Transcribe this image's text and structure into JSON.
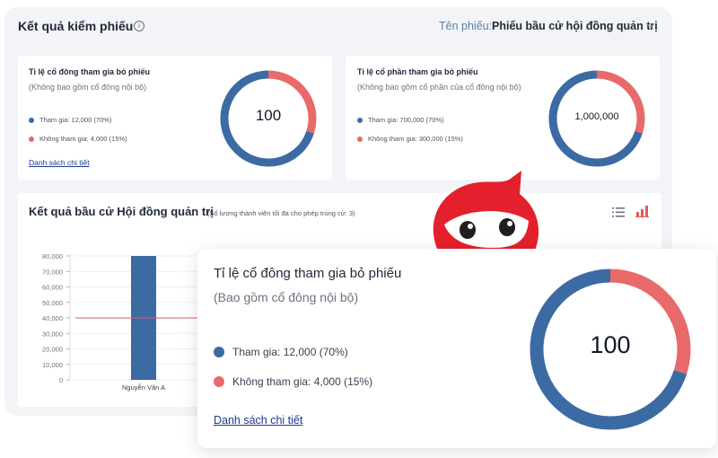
{
  "colors": {
    "participate": "#3c6aa3",
    "absent": "#e86a6a",
    "link": "#1e3a8a",
    "threshold": "#e05a5a"
  },
  "header": {
    "title": "Kết quả kiểm phiếu",
    "ballot_label": "Tên phiếu:",
    "ballot_value": "Phiếu bầu cử hội đồng quản trị"
  },
  "card_shareholders": {
    "title": "Tỉ lệ cổ đông tham gia bỏ phiếu",
    "subtitle": "(Không bao gồm cổ đông nội bộ)",
    "legend_participate": "Tham gia: 12,000 (70%)",
    "legend_absent": "Không tham gia: 4,000 (15%)",
    "link": "Danh sách chi tiết",
    "center_value": "100",
    "participate_fraction": 0.7
  },
  "card_shares": {
    "title": "Tỉ lệ cổ phần tham gia bỏ phiếu",
    "subtitle": "(Không bao gồm cổ phần của cổ đông nội bộ)",
    "legend_participate": "Tham gia: 700,000 (70%)",
    "legend_absent": "Không tham gia: 300,000 (15%)",
    "center_value": "1,000,000",
    "participate_fraction": 0.7
  },
  "election": {
    "title": "Kết quả bầu cử Hội đồng quản trị",
    "note": "(Số lượng thành viên tối đa cho phép trúng cử: 3)",
    "list_icon": "list-icon",
    "chart_icon": "bar-chart-icon"
  },
  "chart_data": {
    "type": "bar",
    "categories": [
      "Nguyễn Văn A"
    ],
    "values": [
      80000
    ],
    "yticks": [
      "80,000",
      "70,000",
      "60,000",
      "50,000",
      "40,000",
      "30,000",
      "20,000",
      "10,000",
      "0"
    ],
    "ylim": [
      0,
      80000
    ],
    "threshold": 40000,
    "grid": true
  },
  "zoom_card": {
    "title": "Tỉ lệ cổ đông tham gia bỏ phiếu",
    "subtitle": "(Bao gồm cổ đông nội bộ)",
    "legend_participate": "Tham gia: 12,000 (70%)",
    "legend_absent": "Không tham gia: 4,000 (15%)",
    "link": "Danh sách chi tiết",
    "center_value": "100",
    "participate_fraction": 0.7
  }
}
